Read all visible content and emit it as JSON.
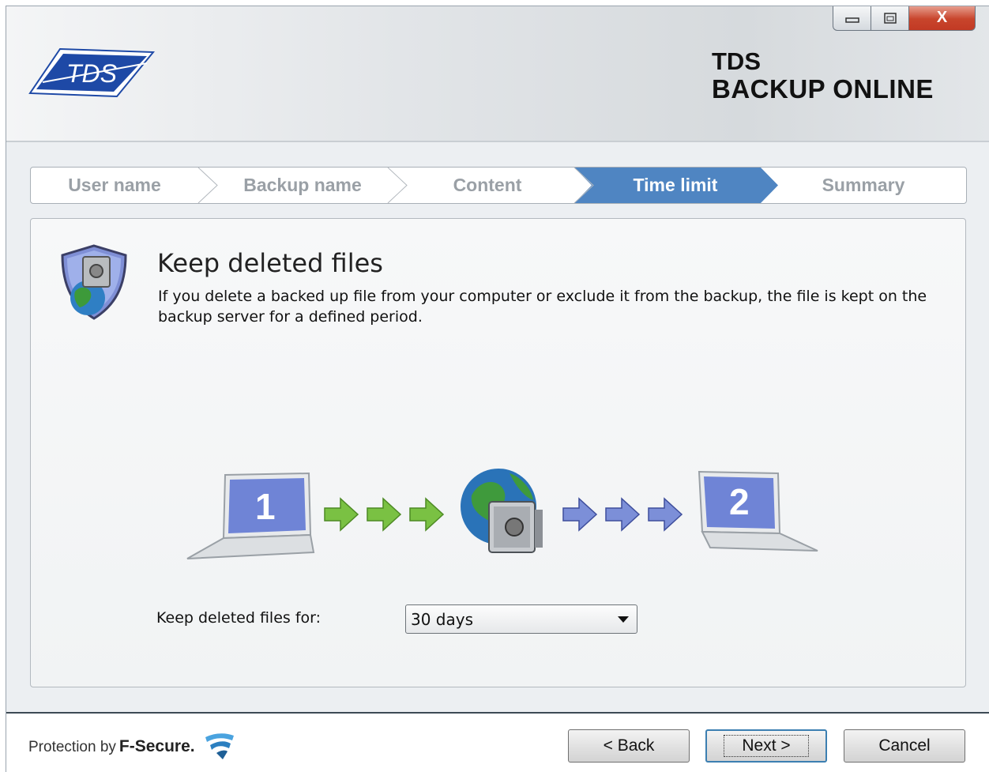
{
  "window": {
    "title_line1": "TDS",
    "title_line2": "BACKUP ONLINE",
    "logo_text": "TDS",
    "close_glyph": "X"
  },
  "steps": [
    {
      "label": "User name",
      "active": false
    },
    {
      "label": "Backup name",
      "active": false
    },
    {
      "label": "Content",
      "active": false
    },
    {
      "label": "Time limit",
      "active": true
    },
    {
      "label": "Summary",
      "active": false
    }
  ],
  "panel": {
    "title": "Keep deleted files",
    "description": "If you delete a backed up file from your computer or exclude it from the backup, the file is kept on the backup server for a defined period.",
    "illustration": {
      "laptop_left_number": "1",
      "laptop_right_number": "2"
    },
    "keep_label": "Keep deleted files for:",
    "keep_select": {
      "selected": "30 days"
    }
  },
  "footer": {
    "protection_by": "Protection by",
    "vendor": "F-Secure.",
    "back": "< Back",
    "next": "Next >",
    "cancel": "Cancel"
  },
  "colors": {
    "active_step": "#4f85c2",
    "green_arrow": "#7ac143",
    "blue_arrow": "#7c8fd8",
    "tds_blue": "#1e49a6"
  },
  "icons": [
    "tds-logo-icon",
    "shield-safe-icon",
    "laptop-icon",
    "globe-safe-icon",
    "f-secure-logo-icon",
    "minimize-icon",
    "maximize-icon",
    "close-icon",
    "chevron-down-icon"
  ]
}
